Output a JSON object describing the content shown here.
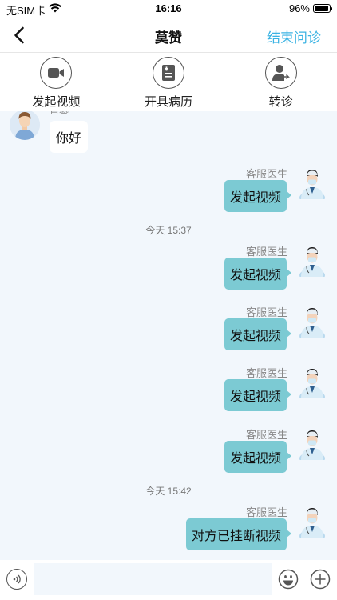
{
  "status_bar": {
    "carrier": "无SIM卡",
    "time": "16:16",
    "battery": "96%",
    "battery_level": 0.96
  },
  "nav": {
    "title": "莫赞",
    "end_button": "结束问诊"
  },
  "toolbar": {
    "items": [
      {
        "label": "发起视频",
        "icon": "video-camera-icon"
      },
      {
        "label": "开具病历",
        "icon": "medical-record-icon"
      },
      {
        "label": "转诊",
        "icon": "referral-icon"
      }
    ]
  },
  "chat": {
    "first_message": {
      "sender": "莫赞",
      "text": "你好"
    },
    "messages": [
      {
        "sender": "客服医生",
        "text": "发起视频"
      },
      {
        "timestamp": "今天 15:37"
      },
      {
        "sender": "客服医生",
        "text": "发起视频"
      },
      {
        "sender": "客服医生",
        "text": "发起视频"
      },
      {
        "sender": "客服医生",
        "text": "发起视频"
      },
      {
        "sender": "客服医生",
        "text": "发起视频"
      },
      {
        "timestamp": "今天 15:42"
      },
      {
        "sender": "客服医生",
        "text": "对方已挂断视频"
      }
    ]
  },
  "input_bar": {
    "placeholder": "",
    "value": ""
  },
  "colors": {
    "accent": "#3bb3e3",
    "bubble_right": "#7ccad3",
    "chat_bg": "#f2f7fc"
  }
}
